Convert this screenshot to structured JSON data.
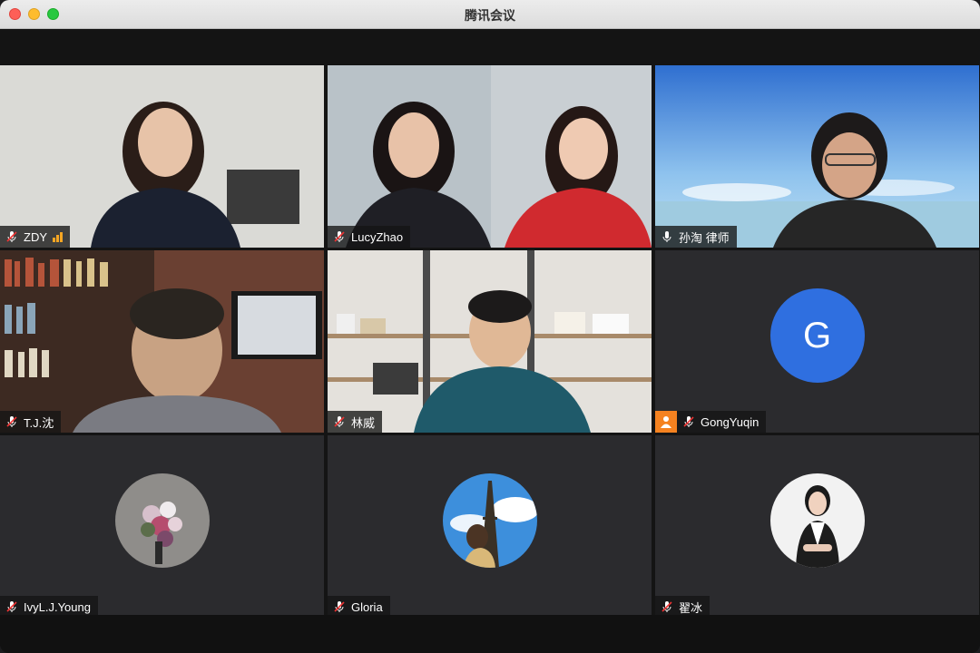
{
  "window": {
    "title": "腾讯会议"
  },
  "tiles": [
    {
      "name": "ZDY",
      "mic": "muted",
      "type": "video"
    },
    {
      "name": "LucyZhao",
      "mic": "muted",
      "type": "video"
    },
    {
      "name": "孙淘 律师",
      "mic": "on",
      "type": "video",
      "speaking": true
    },
    {
      "name": "T.J.沈",
      "mic": "muted",
      "type": "video"
    },
    {
      "name": "林威",
      "mic": "muted",
      "type": "video"
    },
    {
      "name": "GongYuqin",
      "mic": "muted",
      "type": "avatar",
      "avatar_letter": "G"
    },
    {
      "name": "IvyL.J.Young",
      "mic": "muted",
      "type": "avatar"
    },
    {
      "name": "Gloria",
      "mic": "muted",
      "type": "avatar"
    },
    {
      "name": "翟冰",
      "mic": "muted",
      "type": "avatar"
    }
  ],
  "colors": {
    "active_border": "#33c04d",
    "avatar_blue": "#2f6fe0",
    "signal": "#f5a623"
  }
}
